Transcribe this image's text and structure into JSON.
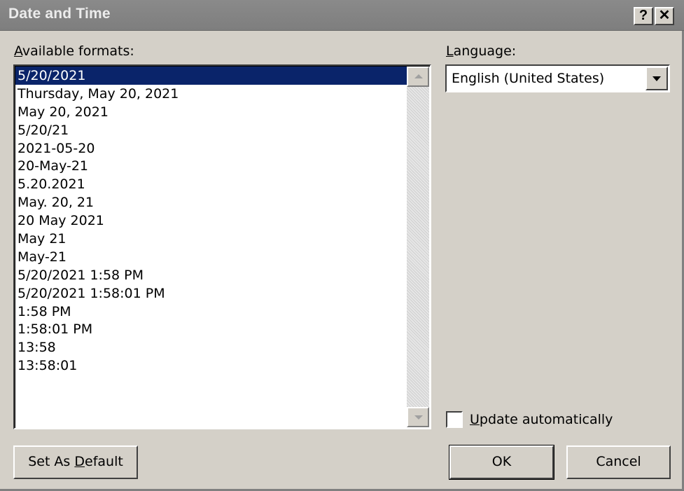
{
  "window": {
    "title": "Date and Time",
    "help_label": "?",
    "close_label": "✕"
  },
  "formats": {
    "label_accel": "A",
    "label_rest": "vailable formats:",
    "items": [
      "5/20/2021",
      "Thursday, May 20, 2021",
      "May 20, 2021",
      "5/20/21",
      "2021-05-20",
      "20-May-21",
      "5.20.2021",
      "May. 20, 21",
      "20 May 2021",
      "May 21",
      "May-21",
      "5/20/2021 1:58 PM",
      "5/20/2021 1:58:01 PM",
      "1:58 PM",
      "1:58:01 PM",
      "13:58",
      "13:58:01"
    ],
    "selected_index": 0
  },
  "language": {
    "label_accel": "L",
    "label_rest": "anguage:",
    "value": "English (United States)"
  },
  "update": {
    "label_accel": "U",
    "label_rest": "pdate automatically",
    "checked": false
  },
  "buttons": {
    "set_default_pre": "Set As ",
    "set_default_accel": "D",
    "set_default_post": "efault",
    "ok": "OK",
    "cancel": "Cancel"
  },
  "colors": {
    "selection": "#0a246a",
    "face": "#d4d0c8",
    "titlebar": "#808080"
  },
  "icons": {
    "scroll_up": "triangle-up",
    "scroll_down": "triangle-down",
    "combo": "triangle-down"
  }
}
